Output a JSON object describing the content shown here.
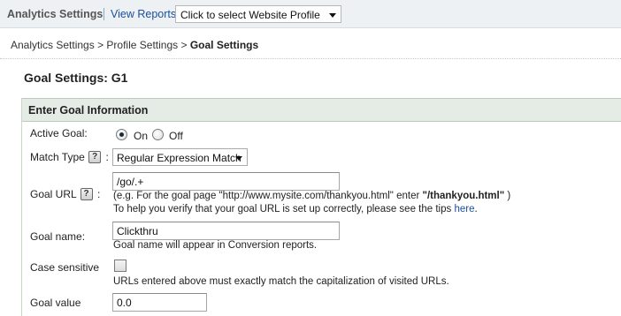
{
  "topbar": {
    "app_title": "Analytics Settings",
    "view_reports_label": "View Reports:",
    "profile_select_value": "Click to select Website Profile"
  },
  "breadcrumb": {
    "item1": "Analytics Settings",
    "item2": "Profile Settings",
    "current": "Goal Settings",
    "separator": ">"
  },
  "page_title": "Goal Settings: G1",
  "panel": {
    "header": "Enter Goal Information"
  },
  "form": {
    "active_goal": {
      "label": "Active Goal:",
      "on_label": "On",
      "off_label": "Off",
      "selected": "On"
    },
    "match_type": {
      "label": "Match Type",
      "suffix": ":",
      "value": "Regular Expression Match"
    },
    "goal_url": {
      "label": "Goal URL",
      "suffix": ":",
      "value": "/go/.+",
      "example_prefix": "(e.g. For the goal page \"http://www.mysite.com/thankyou.html\" enter ",
      "example_bold": "\"/thankyou.html\"",
      "example_suffix": " )",
      "tip_text": "To help you verify that your goal URL is set up correctly, please see the tips ",
      "tip_link": "here",
      "tip_end": "."
    },
    "goal_name": {
      "label": "Goal name:",
      "value": "Clickthru",
      "note": "Goal name will appear in Conversion reports."
    },
    "case_sensitive": {
      "label": "Case sensitive",
      "checked": false,
      "note": "URLs entered above must exactly match the capitalization of visited URLs."
    },
    "goal_value": {
      "label": "Goal value",
      "value": "0.0"
    }
  },
  "icons": {
    "help": "?"
  },
  "colors": {
    "link": "#1a4f9c",
    "topbar_bg": "#eef1f4",
    "panel_header_bg": "#e5ebe5"
  }
}
